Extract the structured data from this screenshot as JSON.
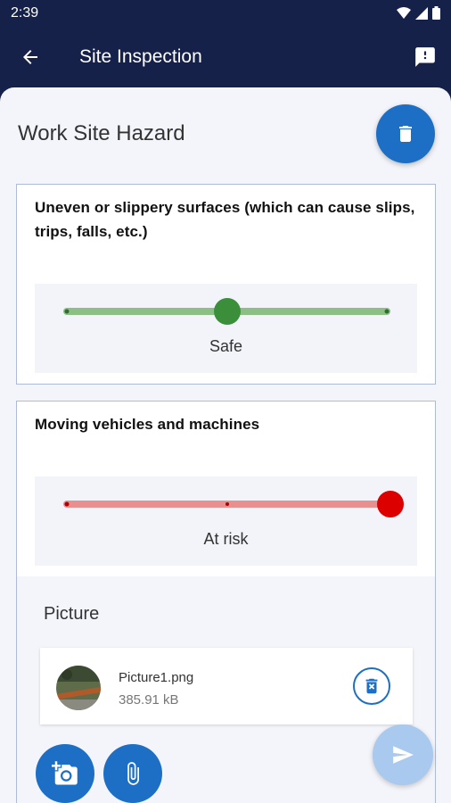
{
  "status_bar": {
    "time": "2:39"
  },
  "app_bar": {
    "title": "Site Inspection"
  },
  "section": {
    "title": "Work Site Hazard"
  },
  "questions": [
    {
      "text": "Uneven or slippery surfaces (which can cause slips, trips, falls, etc.)",
      "rating_label": "Safe",
      "level": 0.5,
      "color": "#3b8f3b",
      "track_color": "#8cbf84"
    },
    {
      "text": "Moving vehicles and machines",
      "rating_label": "At risk",
      "level": 1.0,
      "color": "#dd0000",
      "track_color": "#e88f8f"
    }
  ],
  "picture": {
    "title": "Picture",
    "file_name": "Picture1.png",
    "file_size": "385.91 kB"
  },
  "colors": {
    "primary": "#1d6fc6",
    "header": "#16214a",
    "send_disabled": "#a9c9ee"
  },
  "icons": {
    "back": "arrow-back-icon",
    "feedback": "feedback-icon",
    "delete": "trash-icon",
    "camera": "add-camera-icon",
    "attach": "paperclip-icon",
    "send": "send-icon",
    "file_delete": "delete-file-icon"
  }
}
